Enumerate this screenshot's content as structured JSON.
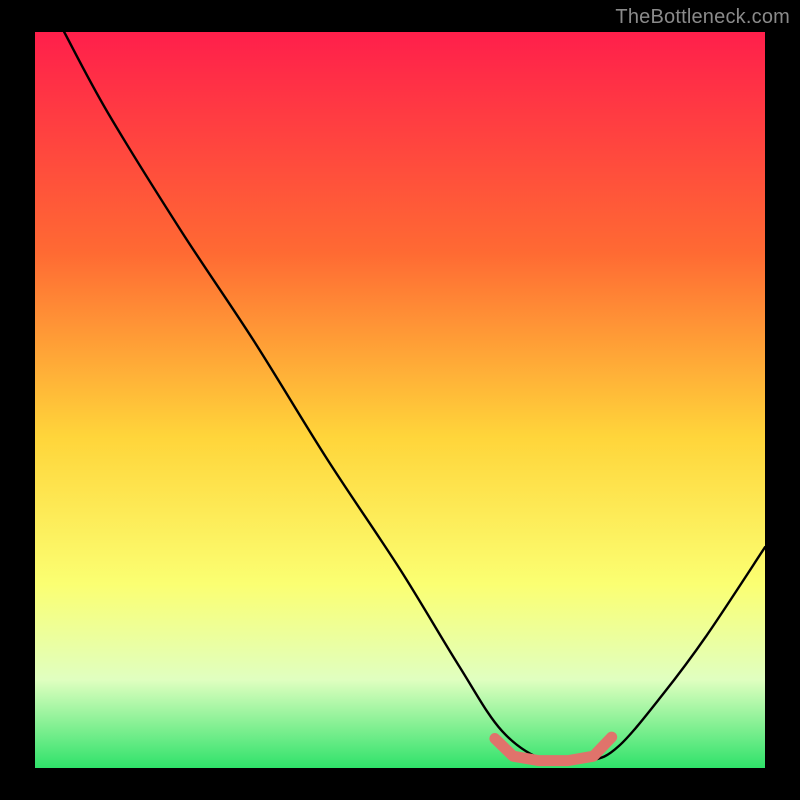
{
  "attribution": "TheBottleneck.com",
  "colors": {
    "frame": "#000000",
    "gradient_top": "#ff1f4b",
    "gradient_mid_upper": "#ff7a2e",
    "gradient_mid": "#fee94a",
    "gradient_lower": "#f4ffbf",
    "gradient_bottom": "#2fe26a",
    "curve": "#000000",
    "marker": "#e0736b",
    "attribution_text": "#8a8a8a"
  },
  "chart_data": {
    "type": "line",
    "title": "",
    "xlabel": "",
    "ylabel": "",
    "xlim": [
      0,
      100
    ],
    "ylim": [
      0,
      100
    ],
    "grid": false,
    "legend": false,
    "series": [
      {
        "name": "bottleneck-curve",
        "x": [
          4,
          10,
          20,
          30,
          40,
          50,
          58,
          64,
          70,
          76,
          80,
          86,
          92,
          100
        ],
        "y": [
          100,
          89,
          73,
          58,
          42,
          27,
          14,
          5,
          1,
          1,
          3,
          10,
          18,
          30
        ]
      }
    ],
    "annotations": [
      {
        "name": "optimal-range-marker",
        "x_start": 63,
        "x_end": 79,
        "y": 1
      }
    ],
    "gradient_stops": [
      {
        "offset": 0,
        "color": "#ff1f4b"
      },
      {
        "offset": 30,
        "color": "#ff6a33"
      },
      {
        "offset": 55,
        "color": "#ffd53a"
      },
      {
        "offset": 75,
        "color": "#fbff72"
      },
      {
        "offset": 88,
        "color": "#e0ffc0"
      },
      {
        "offset": 100,
        "color": "#2fe26a"
      }
    ]
  }
}
